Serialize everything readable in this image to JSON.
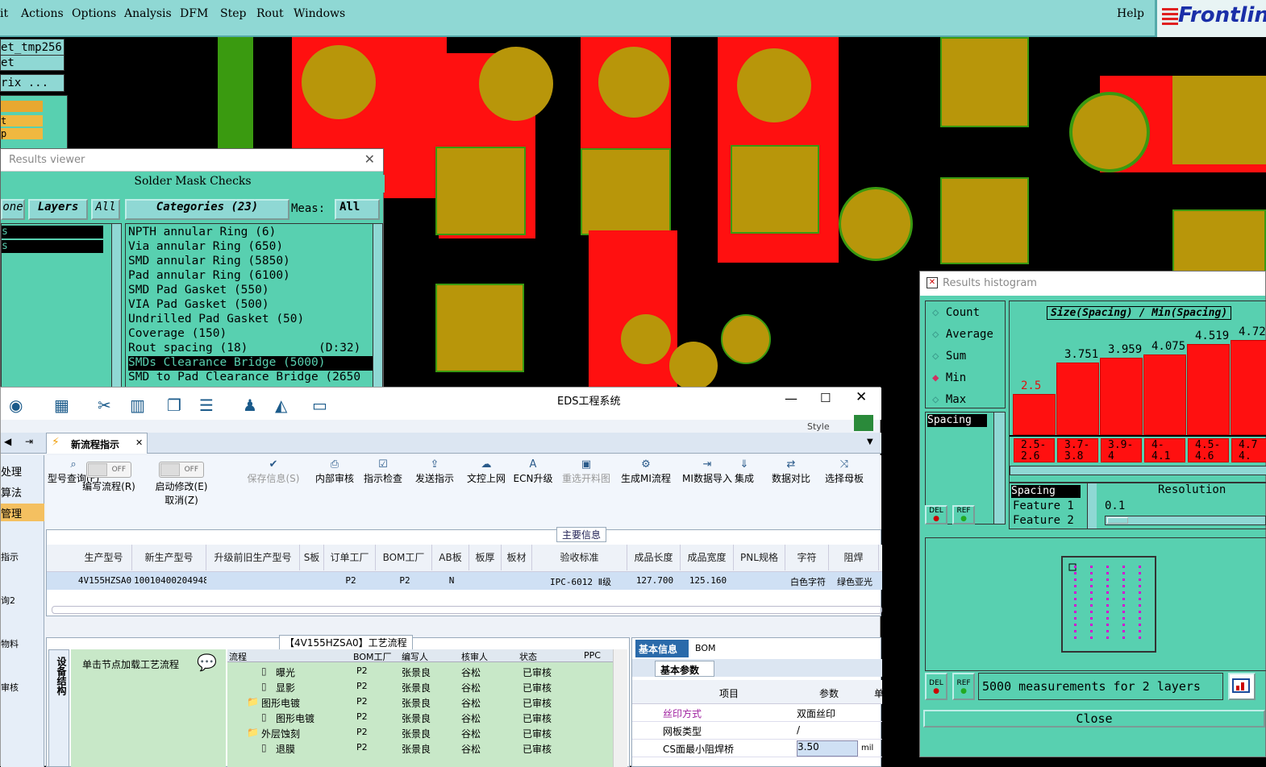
{
  "menu": {
    "items": [
      "it",
      "Actions",
      "Options",
      "Analysis",
      "DFM",
      "Step",
      "Rout",
      "Windows"
    ],
    "help": "Help",
    "logo": "Frontlin"
  },
  "left_panel": {
    "job": "et_tmp256",
    "step": "et",
    "matrix": "rix ...",
    "list_items": [
      "t",
      "p"
    ]
  },
  "results_viewer": {
    "title": "Results viewer",
    "header": "Solder Mask Checks",
    "none_btn": "one",
    "layers_btn": "Layers",
    "all_btn": "All",
    "categories_btn": "Categories (23)",
    "meas_label": "Meas:",
    "meas_value": "All",
    "layers_list": [
      "s",
      "s"
    ],
    "categories": [
      "NPTH annular Ring (6)",
      "Via annular Ring (650)",
      "SMD annular Ring (5850)",
      "Pad annular Ring (6100)",
      "SMD Pad Gasket (550)",
      "VIA Pad Gasket (500)",
      "Undrilled Pad Gasket (50)",
      "Coverage (150)",
      "Rout spacing (18)",
      "SMDs Clearance Bridge (5000)",
      "SMD to Pad Clearance Bridge (2650"
    ],
    "rout_extra": "(D:32)"
  },
  "histogram": {
    "title": "Results histogram",
    "options": [
      "Count",
      "Average",
      "Sum",
      "Min",
      "Max"
    ],
    "selected": "Min",
    "chart_title": "Size(Spacing) / Min(Spacing)",
    "bars": [
      {
        "value": "2.5",
        "low": "2.5-",
        "high": "2.6",
        "level": 0.42
      },
      {
        "value": "3.751",
        "low": "3.7-",
        "high": "3.8",
        "level": 0.74
      },
      {
        "value": "3.959",
        "low": "3.9-",
        "high": "4",
        "level": 0.79
      },
      {
        "value": "4.075",
        "low": "4-",
        "high": "4.1",
        "level": 0.82
      },
      {
        "value": "4.519",
        "low": "4.5-",
        "high": "4.6",
        "level": 0.93
      },
      {
        "value": "4.72",
        "low": "4.7",
        "high": "4.",
        "level": 0.97
      }
    ],
    "attr_list": [
      "Spacing"
    ],
    "feature_list": [
      "Spacing",
      "Feature 1",
      "Feature 2"
    ],
    "resolution_label": "Resolution",
    "resolution_value": "0.1",
    "del": "DEL",
    "ref": "REF",
    "status": "5000 measurements for 2 layers",
    "close": "Close"
  },
  "eds": {
    "title": "EDS工程系统",
    "style": "Style",
    "tab": "新流程指示",
    "nav": [
      "处理",
      "算法",
      "管理"
    ],
    "side_items": [
      "指示",
      "询2",
      "物料",
      "审核"
    ],
    "toggle_off": "OFF",
    "ribbon": [
      {
        "icon": "search-icon",
        "label": "型号查询(F)",
        "glyph": "⌕"
      },
      {
        "icon": "toggle",
        "label": "编写流程(R)",
        "glyph": ""
      },
      {
        "icon": "toggle",
        "label": "启动修改(E)",
        "sub": "取消(Z)",
        "glyph": ""
      },
      {
        "icon": "check-icon",
        "label": "保存信息(S)",
        "glyph": "✔"
      },
      {
        "icon": "print-icon",
        "label": "内部审核",
        "glyph": "⎙"
      },
      {
        "icon": "checkbox-icon",
        "label": "指示检查",
        "glyph": "☑"
      },
      {
        "icon": "upload-icon",
        "label": "发送指示",
        "glyph": "⇪"
      },
      {
        "icon": "cloud-icon",
        "label": "文控上网",
        "glyph": "☁"
      },
      {
        "icon": "ecn-icon",
        "label": "ECN升级",
        "glyph": "A"
      },
      {
        "icon": "image-icon",
        "label": "重选开料图",
        "glyph": "▣"
      },
      {
        "icon": "gears-icon",
        "label": "生成MI流程",
        "glyph": "⚙"
      },
      {
        "icon": "import-icon",
        "label": "MI数据导入",
        "glyph": "⇥"
      },
      {
        "icon": "download-icon",
        "label": "集成",
        "glyph": "⇓"
      },
      {
        "icon": "compare-icon",
        "label": "数据对比",
        "glyph": "⇄"
      },
      {
        "icon": "shuffle-icon",
        "label": "选择母板",
        "glyph": "⤨"
      }
    ],
    "main_info": "主要信息",
    "columns": [
      "生产型号",
      "新生产型号",
      "升级前旧生产型号",
      "S板",
      "订单工厂",
      "BOM工厂",
      "AB板",
      "板厚",
      "板材",
      "验收标准",
      "成品长度",
      "成品宽度",
      "PNL规格",
      "字符",
      "阻焊"
    ],
    "row": [
      "4V155HZSA0",
      "10010400204948",
      "",
      "",
      "P2",
      "P2",
      "N",
      "",
      "",
      "IPC-6012 Ⅱ级",
      "127.700",
      "125.160",
      "",
      "白色字符",
      "绿色亚光"
    ],
    "flow_title": "【4V155HZSA0】工艺流程",
    "device_struct": "设备结构",
    "node_hint": "单击节点加载工艺流程",
    "flow_cols": [
      "流程",
      "BOM工厂",
      "编写人",
      "核审人",
      "状态",
      "PPC"
    ],
    "flow_rows": [
      {
        "name": "曝光",
        "indent": 2,
        "folder": false,
        "bom": "P2",
        "writer": "张景良",
        "reviewer": "谷松",
        "status": "已审核"
      },
      {
        "name": "显影",
        "indent": 2,
        "folder": false,
        "bom": "P2",
        "writer": "张景良",
        "reviewer": "谷松",
        "status": "已审核"
      },
      {
        "name": "图形电镀",
        "indent": 1,
        "folder": true,
        "bom": "P2",
        "writer": "张景良",
        "reviewer": "谷松",
        "status": "已审核"
      },
      {
        "name": "图形电镀",
        "indent": 2,
        "folder": false,
        "bom": "P2",
        "writer": "张景良",
        "reviewer": "谷松",
        "status": "已审核"
      },
      {
        "name": "外层蚀刻",
        "indent": 1,
        "folder": true,
        "bom": "P2",
        "writer": "张景良",
        "reviewer": "谷松",
        "status": "已审核"
      },
      {
        "name": "退膜",
        "indent": 2,
        "folder": false,
        "bom": "P2",
        "writer": "张景良",
        "reviewer": "谷松",
        "status": "已审核"
      }
    ],
    "info_tabs": [
      "基本信息",
      "BOM"
    ],
    "basic_params": "基本参数",
    "param_cols": [
      "项目",
      "参数",
      "单"
    ],
    "params": [
      {
        "name": "丝印方式",
        "value": "双面丝印",
        "unit": ""
      },
      {
        "name": "网板类型",
        "value": "/",
        "unit": ""
      },
      {
        "name": "CS面最小阻焊桥",
        "value": "3.50",
        "unit": "mil"
      }
    ]
  }
}
